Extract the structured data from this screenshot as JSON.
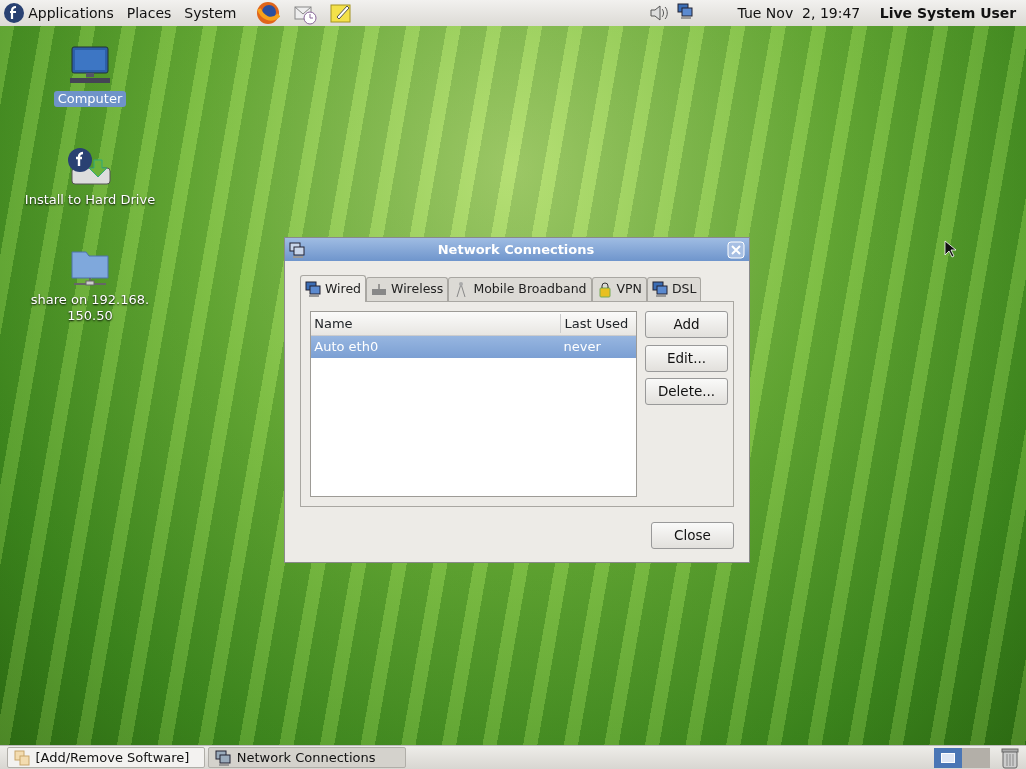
{
  "top_panel": {
    "menus": [
      "Applications",
      "Places",
      "System"
    ],
    "clock": "Tue Nov  2, 19:47",
    "user": "Live System User"
  },
  "desktop_icons": [
    {
      "kind": "computer",
      "lines": [
        "Computer"
      ],
      "selected": true
    },
    {
      "kind": "installer",
      "lines": [
        "Install to Hard Drive"
      ],
      "selected": false
    },
    {
      "kind": "share",
      "lines": [
        "share on 192.168.",
        "150.50"
      ],
      "selected": false
    }
  ],
  "window": {
    "title": "Network Connections",
    "tabs": [
      {
        "label": "Wired",
        "kind": "wired",
        "selected": true
      },
      {
        "label": "Wireless",
        "kind": "wireless",
        "selected": false
      },
      {
        "label": "Mobile Broadband",
        "kind": "mobile",
        "selected": false
      },
      {
        "label": "VPN",
        "kind": "vpn",
        "selected": false
      },
      {
        "label": "DSL",
        "kind": "wired",
        "selected": false
      }
    ],
    "table": {
      "columns": [
        "Name",
        "Last Used"
      ],
      "rows": [
        {
          "cells": [
            "Auto eth0",
            "never"
          ],
          "selected": true
        }
      ]
    },
    "side_buttons": [
      "Add",
      "Edit...",
      "Delete..."
    ],
    "close_button": "Close"
  },
  "taskbar": {
    "tasks": [
      {
        "label": "[Add/Remove Software]",
        "kind": "software",
        "selected": false
      },
      {
        "label": "Network Connections",
        "kind": "network",
        "selected": true
      }
    ],
    "workspaces": [
      {
        "selected": true
      },
      {
        "selected": false
      }
    ]
  }
}
